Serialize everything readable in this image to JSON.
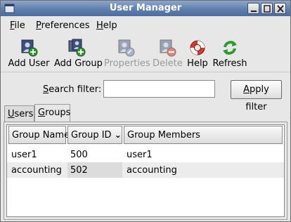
{
  "window": {
    "title": "User Manager"
  },
  "menu": [
    {
      "key": "F",
      "rest": "ile"
    },
    {
      "key": "P",
      "rest": "references"
    },
    {
      "key": "H",
      "rest": "elp"
    }
  ],
  "toolbar": {
    "add_user": "Add User",
    "add_group": "Add Group",
    "properties": "Properties",
    "delete": "Delete",
    "help": "Help",
    "refresh": "Refresh"
  },
  "search": {
    "label_key": "S",
    "label_rest": "earch filter:",
    "value": "",
    "placeholder": "",
    "apply_key": "A",
    "apply_rest": "pply filter"
  },
  "tabs": [
    {
      "key": "U",
      "rest": "sers",
      "active": false
    },
    {
      "key": "G",
      "rest": "roups",
      "active": true
    }
  ],
  "table": {
    "columns": [
      "Group Name",
      "Group ID",
      "Group Members"
    ],
    "sort_indicator": "⌄",
    "rows": [
      {
        "name": "user1",
        "id": "500",
        "members": "user1"
      },
      {
        "name": "accounting",
        "id": "502",
        "members": "accounting"
      }
    ]
  },
  "colors": {
    "titlebar": "#5f7fae",
    "add_green": "#2e9a2e",
    "delete_red": "#d23b2b"
  }
}
